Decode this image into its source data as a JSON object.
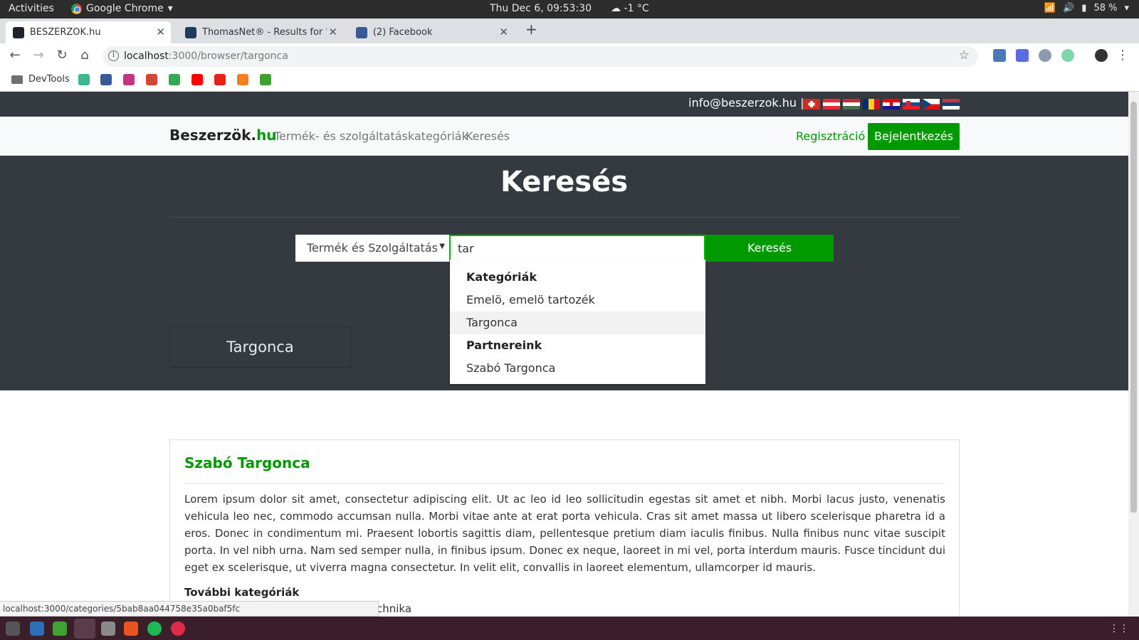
{
  "system": {
    "activities": "Activities",
    "app_name": "Google Chrome",
    "clock": "Thu Dec  6, 09:53:30",
    "weather": "☁ -1 °C",
    "battery": "58 %"
  },
  "tabs": [
    {
      "title": "BESZERZÖK.hu",
      "favicon_color": "#20232a"
    },
    {
      "title": "ThomasNet® - Results for \"fo",
      "favicon_color": "#1f3a5f"
    },
    {
      "title": "(2) Facebook",
      "favicon_color": "#3b5998"
    }
  ],
  "address": {
    "host": "localhost",
    "path": ":3000/browser/targonca"
  },
  "bookmarks": {
    "folder": "DevTools"
  },
  "site": {
    "email": "info@beszerzok.hu",
    "separator": "|",
    "brand_main": "Beszerzök.",
    "brand_suffix": "hu",
    "nav": [
      "Termék- és szolgáltatáskategóriák",
      "Keresés"
    ],
    "register": "Regisztráció",
    "login": "Bejelentkezés"
  },
  "hero": {
    "title": "Keresés",
    "select_value": "Termék és Szolgáltatás",
    "search_value": "tar",
    "search_button": "Keresés",
    "category_card": "Targonca"
  },
  "dropdown": {
    "items": [
      {
        "label": "Kategóriák",
        "type": "header"
      },
      {
        "label": "Emelö, emelö tartozék",
        "type": "item"
      },
      {
        "label": "Targonca",
        "type": "item",
        "highlighted": true
      },
      {
        "label": "Partnereink",
        "type": "header"
      },
      {
        "label": "Szabó Targonca",
        "type": "item"
      }
    ]
  },
  "partner": {
    "name": "Szabó Targonca",
    "description": "Lorem ipsum dolor sit amet, consectetur adipiscing elit. Ut ac leo id leo sollicitudin egestas sit amet et nibh. Morbi lacus justo, venenatis vehicula leo nec, commodo accumsan nulla. Morbi vitae ante at erat porta vehicula. Cras sit amet massa ut libero scelerisque pharetra id a eros. Donec in condimentum mi. Praesent lobortis sagittis diam, pellentesque pretium diam iaculis finibus. Nulla finibus nunc vitae suscipit porta. In vel nibh urna. Nam sed semper nulla, in finibus ipsum. Donec ex neque, laoreet in mi vel, porta interdum mauris. Fusce tincidunt dui eget ex scelerisque, ut viverra magna consectetur. In velit elit, convallis in laoreet elementum, ullamcorper id mauris.",
    "more_label": "További kategóriák",
    "more_item": "chnika"
  },
  "status_url": "localhost:3000/categories/5bab8aa044758e35a0baf5fc",
  "colors": {
    "brand_green": "#009900",
    "dark": "#343a40"
  }
}
